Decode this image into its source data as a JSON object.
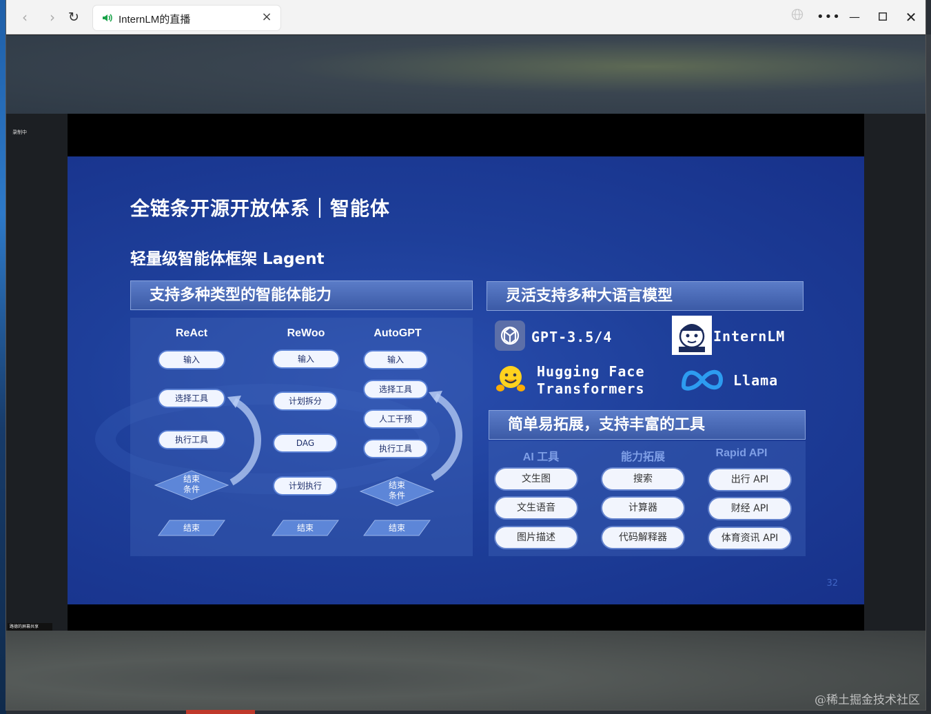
{
  "browser": {
    "tab_title": "InternLM的直播",
    "back_icon": "back-arrow-icon",
    "forward_icon": "forward-arrow-icon",
    "reload_icon": "reload-icon",
    "close_tab": "×",
    "controls": [
      "globe-icon",
      "more-icon",
      "minimize-icon",
      "maximize-icon",
      "close-icon"
    ]
  },
  "overlay": {
    "recording": "录制中",
    "share": "路德的屏幕共享"
  },
  "slide": {
    "title": "全链条开源开放体系｜智能体",
    "subtitle": "轻量级智能体框架 Lagent",
    "left_header": "支持多种类型的智能体能力",
    "right_header": "灵活支持多种大语言模型",
    "tools_header": "简单易拓展，支持丰富的工具",
    "page_number": "32",
    "agents": {
      "react": {
        "title": "ReAct",
        "steps": [
          "输入",
          "选择工具",
          "执行工具"
        ],
        "condition": [
          "结束",
          "条件"
        ],
        "end": "结束"
      },
      "rewoo": {
        "title": "ReWoo",
        "steps": [
          "输入",
          "计划拆分",
          "DAG",
          "计划执行"
        ],
        "end": "结束"
      },
      "autogpt": {
        "title": "AutoGPT",
        "steps": [
          "输入",
          "选择工具",
          "人工干预",
          "执行工具"
        ],
        "condition": [
          "结束",
          "条件"
        ],
        "end": "结束"
      }
    },
    "models": {
      "gpt": "GPT-3.5/4",
      "internlm": "InternLM",
      "hf_line1": "Hugging Face",
      "hf_line2": "Transformers",
      "llama": "Llama"
    },
    "tools": {
      "columns": [
        "AI 工具",
        "能力拓展",
        "Rapid API"
      ],
      "ai": [
        "文生图",
        "文生语音",
        "图片描述"
      ],
      "ability": [
        "搜索",
        "计算器",
        "代码解释器"
      ],
      "rapid": [
        "出行 API",
        "财经 API",
        "体育资讯 API"
      ]
    }
  },
  "watermark": "@稀土掘金技术社区",
  "colors": {
    "slide_bg": "#1e3f9a",
    "header_bg": "#4a6bb8",
    "tab_speaker": "#1aa34a"
  }
}
